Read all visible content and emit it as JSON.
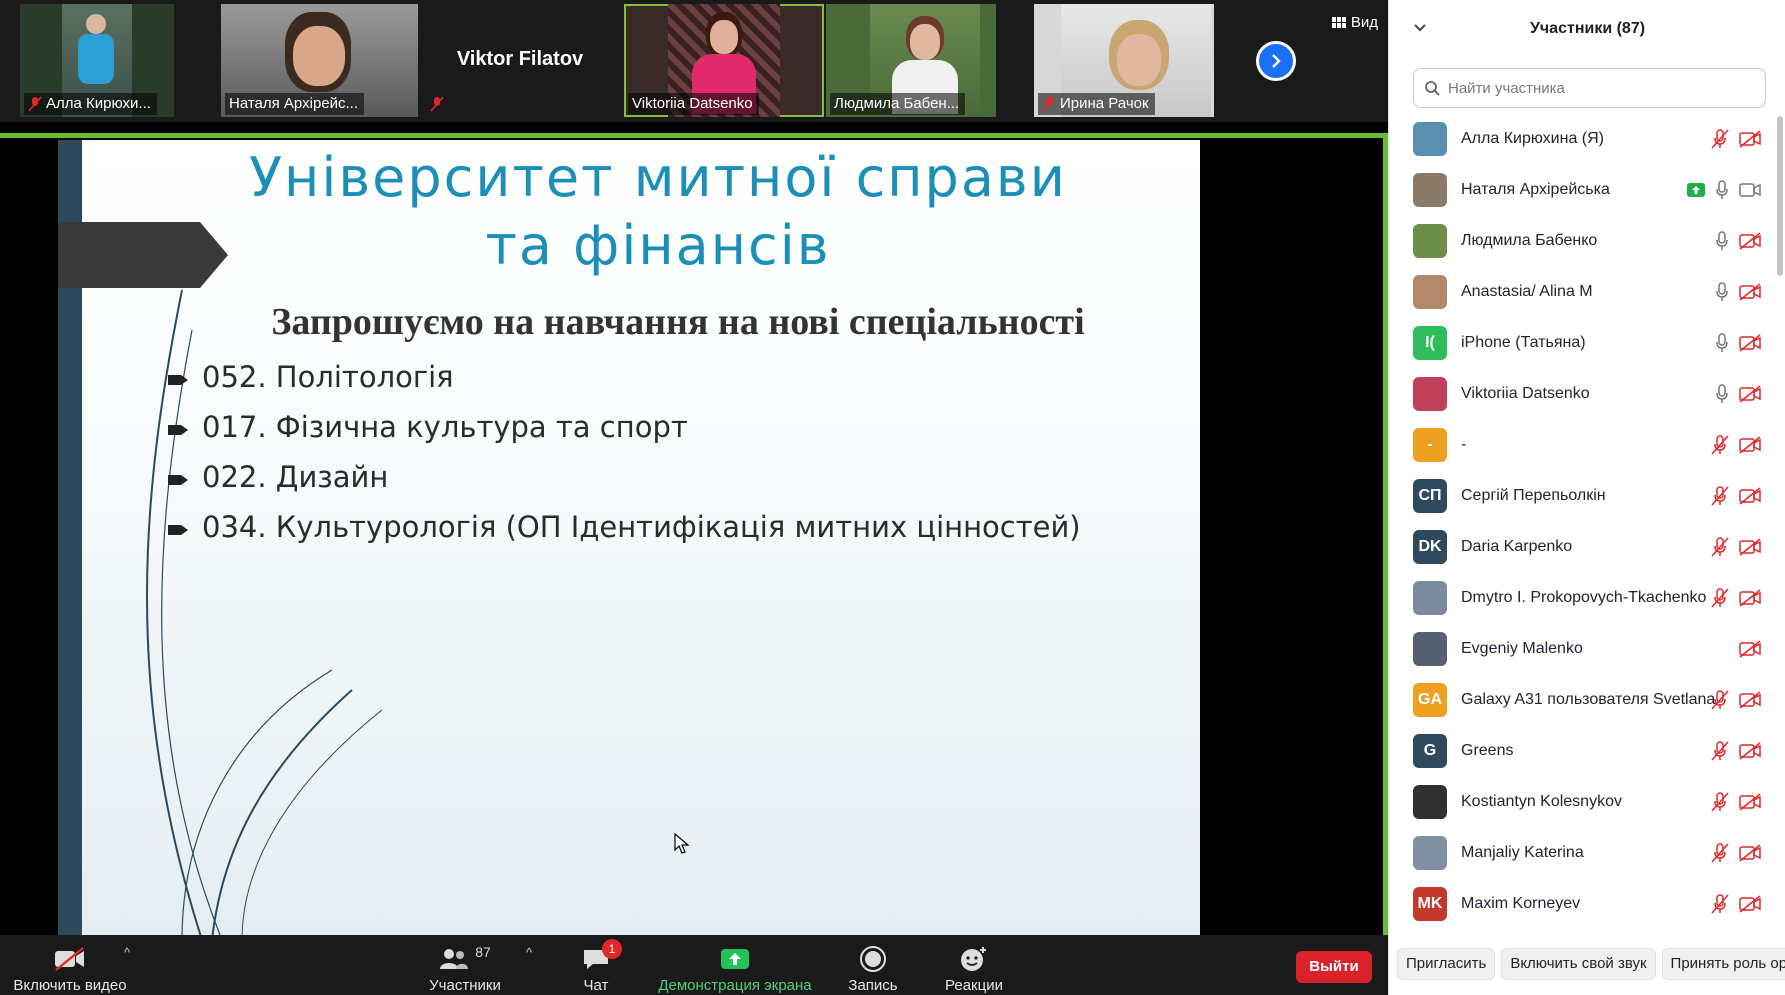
{
  "strip": {
    "tiles": [
      {
        "name": "Алла Кирюхи...",
        "muted": true
      },
      {
        "name": "Наталя Архірейс...",
        "muted": false
      },
      {
        "name": "Viktor Filatov",
        "muted": true
      },
      {
        "name": "Viktoriia Datsenko",
        "muted": false
      },
      {
        "name": "Людмила Бабен...",
        "muted": false
      },
      {
        "name": "Ирина Рачок",
        "muted": true
      }
    ],
    "view_label": "Вид",
    "next_icon": "chevron-right-icon"
  },
  "slide": {
    "title": "Університет митної справи та фінансів",
    "subtitle": "Запрошуємо на навчання на нові спеціальності",
    "items": [
      "052. Політологія",
      "017. Фізична культура та спорт",
      "022. Дизайн",
      "034. Культурологія (ОП Ідентифікація митних цінностей)"
    ]
  },
  "toolbar": {
    "video_label": "Включить видео",
    "participants_label": "Участники",
    "participants_count": "87",
    "chat_label": "Чат",
    "chat_badge": "1",
    "share_label": "Демонстрация экрана",
    "record_label": "Запись",
    "reactions_label": "Реакции",
    "leave_label": "Выйти"
  },
  "panel": {
    "title": "Участники (87)",
    "search_placeholder": "Найти участника",
    "participants": [
      {
        "name": "Алла Кирюхина (Я)",
        "avatar": "",
        "color": "#5b8fb0",
        "mic": "muted",
        "cam": "off"
      },
      {
        "name": "Наталя Архірейська",
        "avatar": "",
        "color": "#8a7a6a",
        "mic": "on",
        "cam": "on",
        "sharing": true
      },
      {
        "name": "Людмила Бабенко",
        "avatar": "",
        "color": "#6d8f4a",
        "mic": "on",
        "cam": "off"
      },
      {
        "name": "Anastasia/ Alina M",
        "avatar": "",
        "color": "#b08a6a",
        "mic": "on",
        "cam": "off"
      },
      {
        "name": "iPhone (Татьяна)",
        "avatar": "I(",
        "color": "#2ebd5c",
        "mic": "on",
        "cam": "off"
      },
      {
        "name": "Viktoriia Datsenko",
        "avatar": "",
        "color": "#c0405a",
        "mic": "on",
        "cam": "off"
      },
      {
        "name": "-",
        "avatar": "-",
        "color": "#f0a020",
        "mic": "muted",
        "cam": "off"
      },
      {
        "name": "Сергій Перепьолкін",
        "avatar": "СП",
        "color": "#2f4a5f",
        "mic": "muted",
        "cam": "off"
      },
      {
        "name": "Daria Karpenko",
        "avatar": "DK",
        "color": "#2f4a5f",
        "mic": "muted",
        "cam": "off"
      },
      {
        "name": "Dmytro I. Prokopovych-Tkachenko",
        "avatar": "",
        "color": "#7a8a9a",
        "mic": "muted",
        "cam": "off"
      },
      {
        "name": "Evgeniy Malenko",
        "avatar": "",
        "color": "#556070",
        "mic": "none",
        "cam": "off"
      },
      {
        "name": "Galaxy A31 пользователя Svetlana",
        "avatar": "GA",
        "color": "#f0a020",
        "mic": "muted",
        "cam": "off"
      },
      {
        "name": "Greens",
        "avatar": "G",
        "color": "#2f4a5f",
        "mic": "muted",
        "cam": "off"
      },
      {
        "name": "Kostiantyn Kolesnykov",
        "avatar": "",
        "color": "#303030",
        "mic": "muted",
        "cam": "off"
      },
      {
        "name": "Manjaliy Katerina",
        "avatar": "",
        "color": "#8090a0",
        "mic": "muted",
        "cam": "off"
      },
      {
        "name": "Maxim Korneyev",
        "avatar": "MK",
        "color": "#c0392b",
        "mic": "muted",
        "cam": "off"
      }
    ],
    "footer": {
      "invite_label": "Пригласить",
      "unmute_label": "Включить свой звук",
      "claim_host_label": "Принять роль орг"
    }
  }
}
